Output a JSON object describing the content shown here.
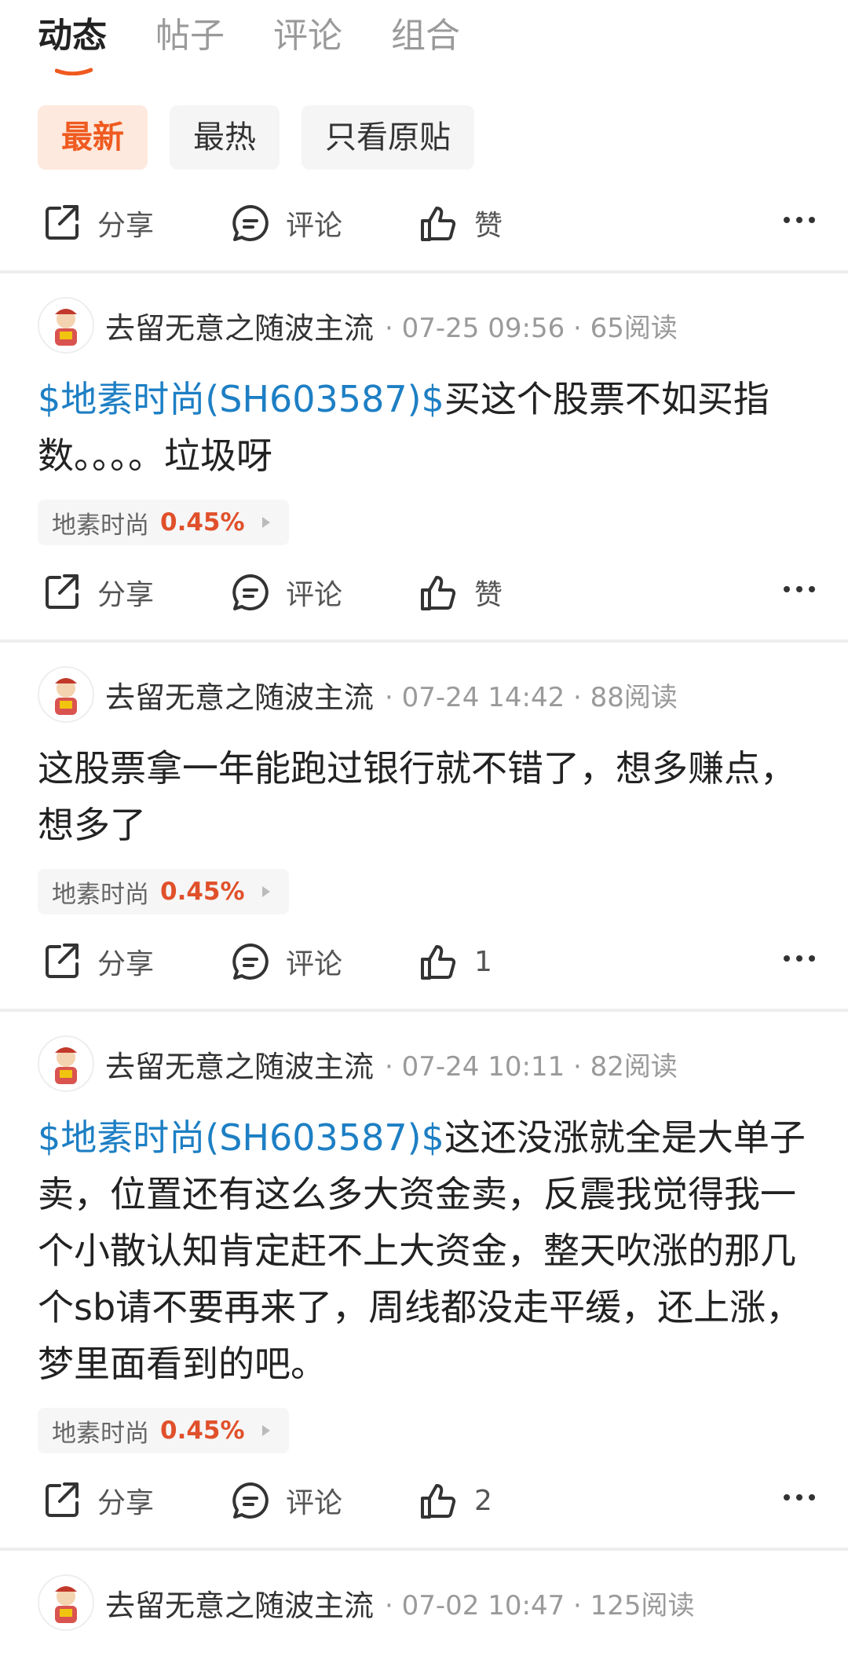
{
  "tabs": [
    "动态",
    "帖子",
    "评论",
    "组合"
  ],
  "filters": [
    "最新",
    "最热",
    "只看原贴"
  ],
  "action_labels": {
    "share": "分享",
    "comment": "评论",
    "like": "赞"
  },
  "stock_tag": {
    "name": "地素时尚",
    "change": "0.45%"
  },
  "top_actions": {
    "like": "赞"
  },
  "posts": [
    {
      "author": "去留无意之随波主流",
      "meta": "· 07-25 09:56 · 65阅读",
      "ticker": "$地素时尚(SH603587)$",
      "text": "买这个股票不如买指数。。。。垃圾呀",
      "like": "赞"
    },
    {
      "author": "去留无意之随波主流",
      "meta": "· 07-24 14:42 · 88阅读",
      "ticker": "",
      "text": "这股票拿一年能跑过银行就不错了，想多赚点，想多了",
      "like": "1"
    },
    {
      "author": "去留无意之随波主流",
      "meta": "· 07-24 10:11 · 82阅读",
      "ticker": "$地素时尚(SH603587)$",
      "text": "这还没涨就全是大单子卖，位置还有这么多大资金卖，反震我觉得我一个小散认知肯定赶不上大资金，整天吹涨的那几个sb请不要再来了，周线都没走平缓，还上涨，梦里面看到的吧。",
      "like": "2"
    },
    {
      "author": "去留无意之随波主流",
      "meta": "· 07-02 10:47 · 125阅读"
    }
  ],
  "colors": {
    "accent": "#ef5a1f",
    "ticker": "#1d7fc4",
    "change": "#e0502a"
  }
}
